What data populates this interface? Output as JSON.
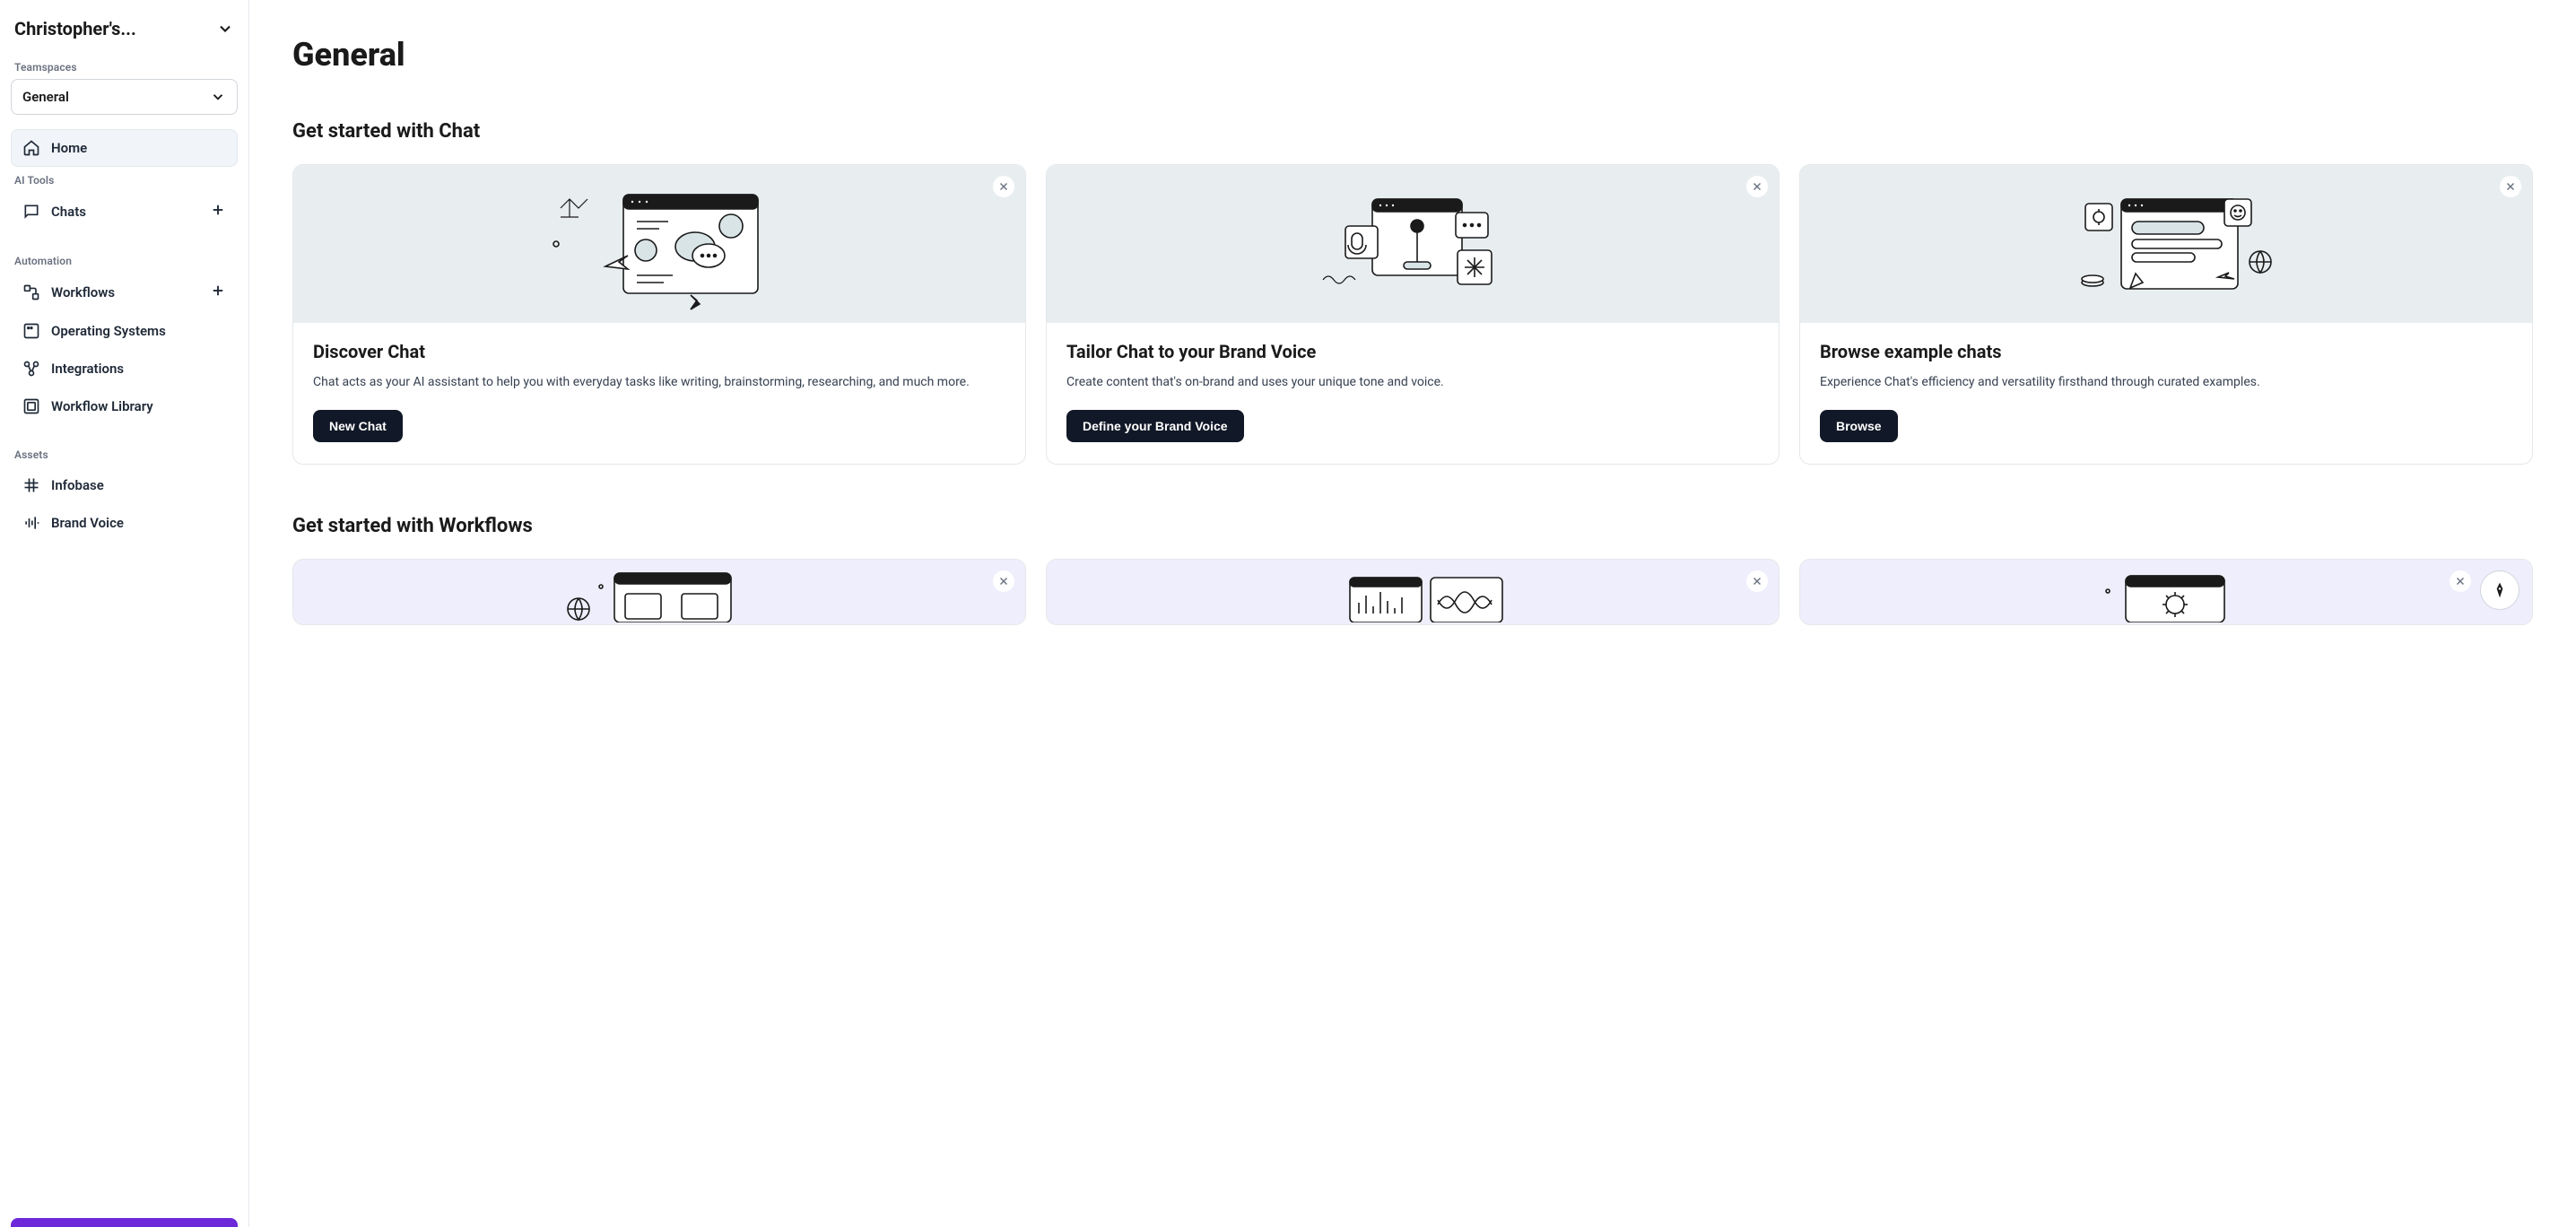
{
  "workspace": {
    "name": "Christopher's..."
  },
  "sidebar": {
    "teamspaces_label": "Teamspaces",
    "teamspace_selected": "General",
    "home_label": "Home",
    "ai_tools_label": "AI Tools",
    "chats_label": "Chats",
    "automation_label": "Automation",
    "workflows_label": "Workflows",
    "operating_systems_label": "Operating Systems",
    "integrations_label": "Integrations",
    "workflow_library_label": "Workflow Library",
    "assets_label": "Assets",
    "infobase_label": "Infobase",
    "brand_voice_label": "Brand Voice"
  },
  "page": {
    "title": "General",
    "chat_section_title": "Get started with Chat",
    "workflow_section_title": "Get started with Workflows"
  },
  "cards": {
    "discover": {
      "title": "Discover Chat",
      "desc": "Chat acts as your AI assistant to help you with everyday tasks like writing, brainstorming, researching, and much more.",
      "button": "New Chat"
    },
    "brand": {
      "title": "Tailor Chat to your Brand Voice",
      "desc": "Create content that's on-brand and uses your unique tone and voice.",
      "button": "Define your Brand Voice"
    },
    "examples": {
      "title": "Browse example chats",
      "desc": "Experience Chat's efficiency and versatility firsthand through curated examples.",
      "button": "Browse"
    }
  }
}
